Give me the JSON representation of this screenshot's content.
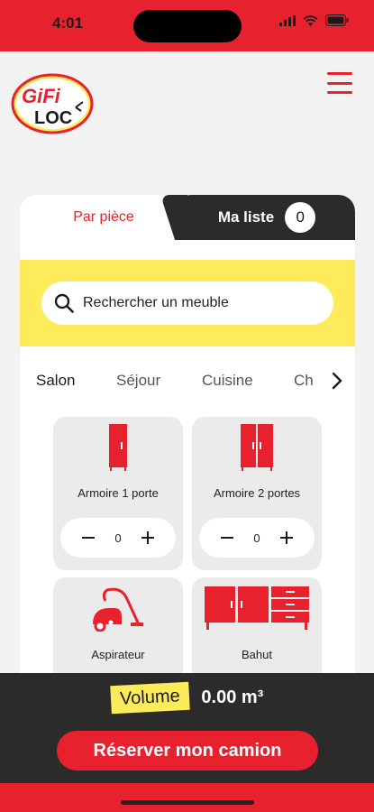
{
  "status_bar": {
    "time": "4:01"
  },
  "header": {
    "logo_top": "GiFi",
    "logo_bottom": "LOC"
  },
  "tabs": {
    "by_room": "Par pièce",
    "my_list": "Ma liste",
    "my_list_count": "0"
  },
  "search": {
    "placeholder": "Rechercher un meuble"
  },
  "rooms": [
    "Salon",
    "Séjour",
    "Cuisine",
    "Ch"
  ],
  "active_room": "Salon",
  "items": [
    {
      "label": "Armoire 1 porte",
      "quantity": "0",
      "icon": "wardrobe-1-door-icon"
    },
    {
      "label": "Armoire 2 portes",
      "quantity": "0",
      "icon": "wardrobe-2-doors-icon"
    },
    {
      "label": "Aspirateur",
      "icon": "vacuum-icon"
    },
    {
      "label": "Bahut",
      "icon": "sideboard-icon"
    }
  ],
  "footer": {
    "volume_label": "Volume",
    "volume_value": "0.00 m³",
    "reserve_label": "Réserver mon camion"
  },
  "colors": {
    "brand_red": "#e8212e",
    "brand_yellow": "#fdeb59",
    "dark": "#2b2b2b"
  }
}
